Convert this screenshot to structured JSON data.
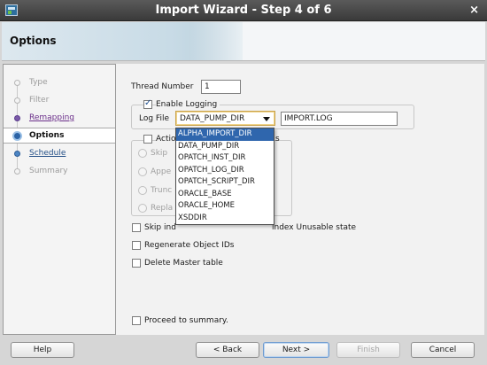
{
  "window": {
    "title": "Import Wizard - Step 4 of 6"
  },
  "header": {
    "title": "Options"
  },
  "nav": {
    "items": [
      {
        "label": "Type",
        "state": "done"
      },
      {
        "label": "Filter",
        "state": "done"
      },
      {
        "label": "Remapping",
        "state": "link"
      },
      {
        "label": "Options",
        "state": "current"
      },
      {
        "label": "Schedule",
        "state": "link"
      },
      {
        "label": "Summary",
        "state": "pending"
      }
    ]
  },
  "form": {
    "thread_number_label": "Thread Number",
    "thread_number_value": "1",
    "enable_logging_label": "Enable Logging",
    "enable_logging_checked": true,
    "log_file_label": "Log File",
    "log_dir_selected": "DATA_PUMP_DIR",
    "log_file_name": "IMPORT.LOG",
    "log_dir_options": [
      "ALPHA_IMPORT_DIR",
      "DATA_PUMP_DIR",
      "OPATCH_INST_DIR",
      "OPATCH_LOG_DIR",
      "OPATCH_SCRIPT_DIR",
      "ORACLE_BASE",
      "ORACLE_HOME",
      "XSDDIR"
    ],
    "action_label_visible": "Actio",
    "action_label_tail": "s",
    "action_options_visible": [
      "Skip",
      "Appe",
      "Trunc",
      "Repla"
    ],
    "skip_indexes_visible": "Skip ind",
    "skip_indexes_tail": "index Unusable state",
    "regenerate_ids_label": "Regenerate Object IDs",
    "delete_master_label": "Delete Master table",
    "proceed_summary_label": "Proceed to summary."
  },
  "buttons": {
    "help": "Help",
    "back": "< Back",
    "next": "Next >",
    "finish": "Finish",
    "cancel": "Cancel"
  }
}
